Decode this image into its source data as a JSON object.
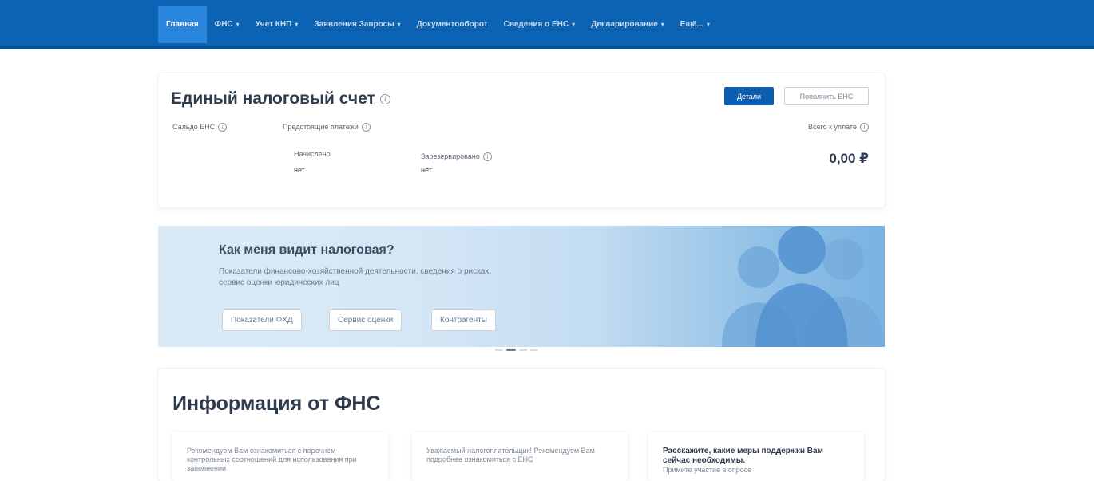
{
  "nav": {
    "items": [
      {
        "label": "Главная",
        "active": true,
        "dropdown": false
      },
      {
        "label": "ФНС",
        "active": false,
        "dropdown": true
      },
      {
        "label": "Учет КНП",
        "active": false,
        "dropdown": true
      },
      {
        "label": "Заявления Запросы",
        "active": false,
        "dropdown": true
      },
      {
        "label": "Документооборот",
        "active": false,
        "dropdown": false
      },
      {
        "label": "Сведения о ЕНС",
        "active": false,
        "dropdown": true
      },
      {
        "label": "Декларирование",
        "active": false,
        "dropdown": true
      },
      {
        "label": "Ещё...",
        "active": false,
        "dropdown": true
      }
    ]
  },
  "ens": {
    "title": "Единый налоговый счет",
    "details_button": "Детали",
    "pay_button": "Пополнить ЕНС",
    "balance_label": "Сальдо ЕНС",
    "obligations_label": "Предстоящие платежи",
    "accrued_label": "Начислено",
    "accrued_value": "нет",
    "reserved_label": "Зарезервировано",
    "reserved_value": "нет",
    "total_label": "Всего к уплате",
    "amount": "0,00 ₽"
  },
  "banner": {
    "title": "Как меня видит налоговая?",
    "text": "Показатели финансово-хозяйственной деятельности, сведения о рисках, сервис оценки юридических лиц",
    "buttons": [
      "Показатели ФХД",
      "Сервис оценки",
      "Контрагенты"
    ]
  },
  "info": {
    "title": "Информация от ФНС",
    "news": [
      {
        "text": "Рекомендуем Вам ознакомиться с перечнем контрольных соотношений для использования при заполнении",
        "strong": false
      },
      {
        "text": "Уважаемый налогоплательщик! Рекомендуем Вам подробнее ознакомиться с ЕНС",
        "strong": false
      },
      {
        "text": "Расскажите, какие меры поддержки Вам сейчас необходимы.",
        "strong": true,
        "sub": "Примите участие в опросе"
      }
    ]
  },
  "colors": {
    "nav_bg": "#0c63b3",
    "nav_active": "#2a86dd",
    "primary_btn": "#0d5eb0"
  }
}
